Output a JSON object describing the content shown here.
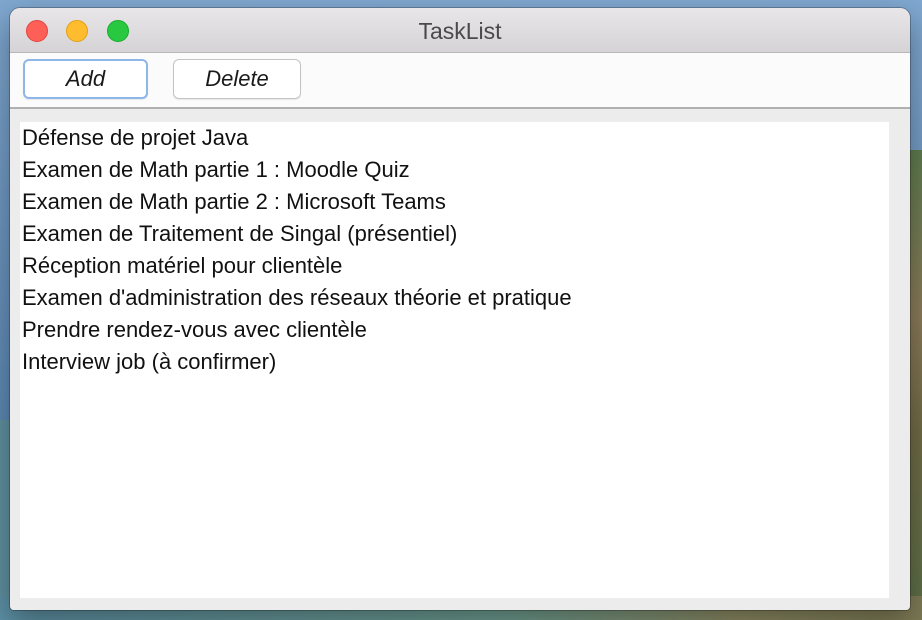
{
  "window": {
    "title": "TaskList"
  },
  "toolbar": {
    "add_label": "Add",
    "delete_label": "Delete"
  },
  "tasks": [
    "Défense de projet Java",
    "Examen de Math partie 1 : Moodle Quiz",
    "Examen de Math partie 2 : Microsoft Teams",
    "Examen de Traitement de Singal (présentiel)",
    "Réception matériel pour clientèle",
    "Examen d'administration des réseaux théorie et pratique",
    "Prendre rendez-vous avec clientèle",
    "Interview job (à confirmer)"
  ],
  "colors": {
    "close": "#fe5f57",
    "minimize": "#febc2e",
    "zoom": "#28c840",
    "focus_ring": "#8fb6e8"
  }
}
